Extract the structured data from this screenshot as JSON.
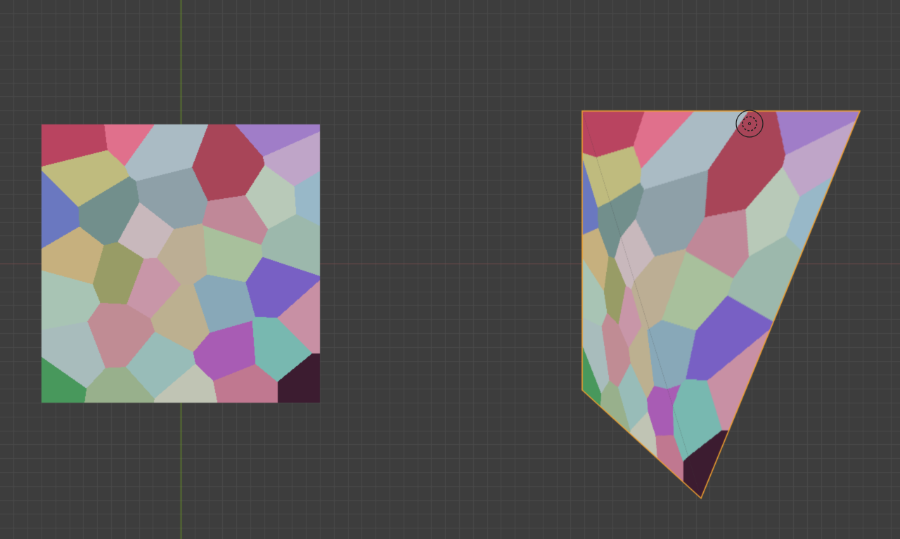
{
  "viewport": {
    "background_color": "#3d3d3d",
    "grid_color": "#4a4a4a",
    "y_axis_color": "#5f7f2c",
    "x_axis_color": "#6e4a4a",
    "selection_outline_color": "#f0a030"
  },
  "cursor": {
    "icon": "3d-cursor-icon"
  }
}
